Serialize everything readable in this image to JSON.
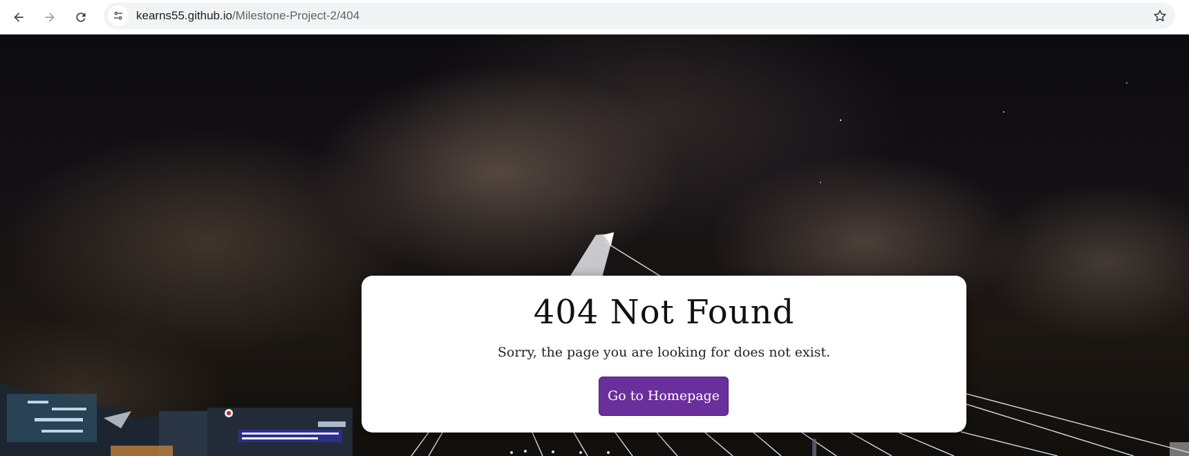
{
  "browser": {
    "url_domain": "kearns55.github.io",
    "url_path": "/Milestone-Project-2/404"
  },
  "card": {
    "title": "404 Not Found",
    "message": "Sorry, the page you are looking for does not exist.",
    "button_label": "Go to Homepage",
    "button_color": "#6a2f9b"
  },
  "icons": {
    "back": "arrow-left-icon",
    "forward": "arrow-right-icon",
    "reload": "reload-icon",
    "site_info": "tune-icon",
    "bookmark": "star-icon"
  }
}
